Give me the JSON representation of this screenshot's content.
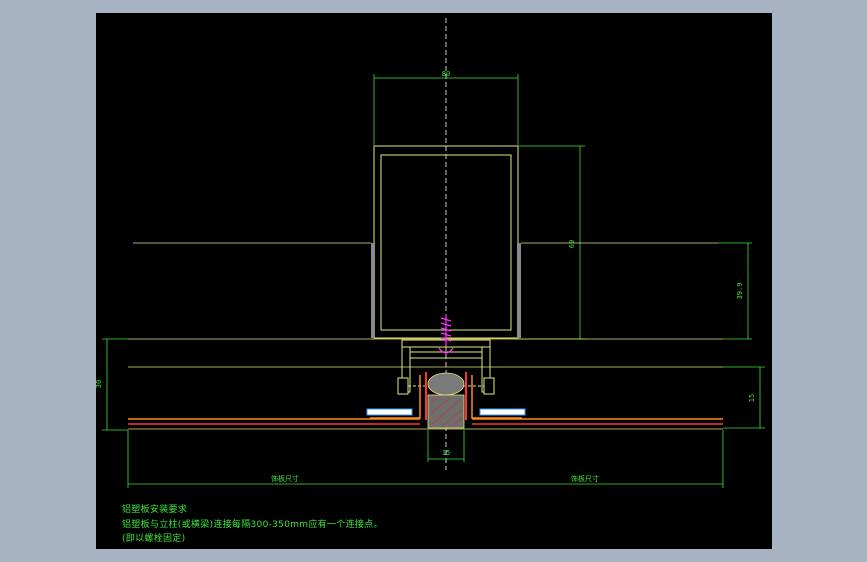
{
  "drawing": {
    "dimensions": {
      "top_width": "80",
      "tube_height": "60",
      "right_offset": "39.9",
      "left_height": "30",
      "right_small": "15",
      "gap": "15",
      "left_span": "饰板尺寸",
      "right_span": "饰板尺寸"
    },
    "notes": {
      "title": "铝塑板安装要求",
      "line1": "铝塑板与立柱(或横梁)连接每隔300-350mm应有一个连接点。",
      "line2": "(即以螺栓固定)"
    }
  },
  "colors": {
    "background": "#a7b3c3",
    "canvas": "#000000",
    "dimension": "#39e639",
    "outline": "#e6e67a",
    "panel": "#ff8c1a",
    "screw": "#ff33ff",
    "centerline": "#ffffff"
  }
}
